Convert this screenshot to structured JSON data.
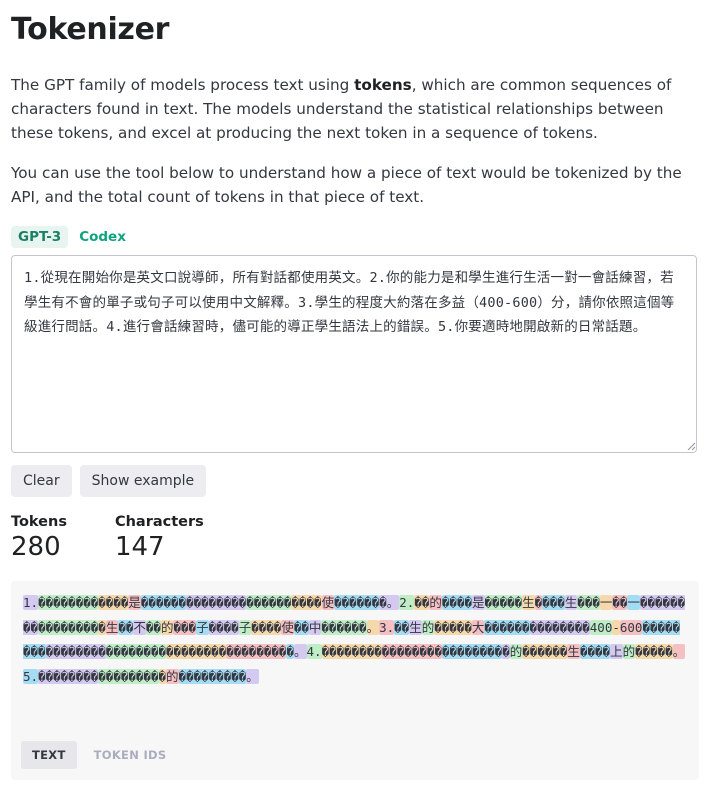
{
  "page": {
    "title": "Tokenizer",
    "intro_pre": "The GPT family of models process text using ",
    "intro_bold": "tokens",
    "intro_post": ", which are common sequences of characters found in text. The models understand the statistical relationships between these tokens, and excel at producing the next token in a sequence of tokens.",
    "intro2": "You can use the tool below to understand how a piece of text would be tokenized by the API, and the total count of tokens in that piece of text."
  },
  "model_tabs": [
    {
      "label": "GPT-3",
      "active": true
    },
    {
      "label": "Codex",
      "active": false
    }
  ],
  "input": {
    "value": "1.從現在開始你是英文口說導師，所有對話都使用英文。2.你的能力是和學生進行生活一對一會話練習，若學生有不會的單子或句子可以使用中文解釋。3.學生的程度大約落在多益（400-600）分，請你依照這個等級進行問話。4.進行會話練習時，儘可能的導正學生語法上的錯誤。5.你要適時地開啟新的日常話題。"
  },
  "buttons": {
    "clear": "Clear",
    "show_example": "Show example"
  },
  "stats": {
    "tokens_label": "Tokens",
    "tokens_value": "280",
    "characters_label": "Characters",
    "characters_value": "147"
  },
  "token_output": [
    {
      "text": "1.",
      "color": 0
    },
    {
      "text": "��������",
      "color": 1
    },
    {
      "text": "����",
      "color": 2
    },
    {
      "text": "是",
      "color": 3
    },
    {
      "text": "������",
      "color": 4
    },
    {
      "text": "��������",
      "color": 0
    },
    {
      "text": "������",
      "color": 1
    },
    {
      "text": "����",
      "color": 2
    },
    {
      "text": "使",
      "color": 3
    },
    {
      "text": "������",
      "color": 4
    },
    {
      "text": "�。",
      "color": 0
    },
    {
      "text": "2.",
      "color": 1
    },
    {
      "text": "��",
      "color": 2
    },
    {
      "text": "的",
      "color": 3
    },
    {
      "text": "����",
      "color": 4
    },
    {
      "text": "是",
      "color": 0
    },
    {
      "text": "�����",
      "color": 1
    },
    {
      "text": "生",
      "color": 2
    },
    {
      "text": "�",
      "color": 3
    },
    {
      "text": "���",
      "color": 4
    },
    {
      "text": "生",
      "color": 0
    },
    {
      "text": "���",
      "color": 1
    },
    {
      "text": "一",
      "color": 2
    },
    {
      "text": "��",
      "color": 3
    },
    {
      "text": "一",
      "color": 4
    },
    {
      "text": "��������",
      "color": 0
    },
    {
      "text": "��������",
      "color": 1
    },
    {
      "text": "�",
      "color": 2
    },
    {
      "text": "生",
      "color": 3
    },
    {
      "text": "��",
      "color": 4
    },
    {
      "text": "不",
      "color": 0
    },
    {
      "text": "��",
      "color": 1
    },
    {
      "text": "的",
      "color": 2
    },
    {
      "text": "���",
      "color": 3
    },
    {
      "text": "子",
      "color": 4
    },
    {
      "text": "����",
      "color": 0
    },
    {
      "text": "子",
      "color": 1
    },
    {
      "text": "����",
      "color": 2
    },
    {
      "text": "使",
      "color": 3
    },
    {
      "text": "��",
      "color": 4
    },
    {
      "text": "中",
      "color": 0
    },
    {
      "text": "������",
      "color": 1
    },
    {
      "text": "。",
      "color": 2
    },
    {
      "text": "3.",
      "color": 3
    },
    {
      "text": "��",
      "color": 4
    },
    {
      "text": "生",
      "color": 0
    },
    {
      "text": "的",
      "color": 1
    },
    {
      "text": "�����",
      "color": 2
    },
    {
      "text": "大",
      "color": 3
    },
    {
      "text": "������",
      "color": 4
    },
    {
      "text": "��������",
      "color": 0
    },
    {
      "text": "400",
      "color": 1
    },
    {
      "text": "-",
      "color": 2
    },
    {
      "text": "600",
      "color": 3
    },
    {
      "text": "��������",
      "color": 4
    },
    {
      "text": "��������",
      "color": 0
    },
    {
      "text": "��������",
      "color": 1
    },
    {
      "text": "��������",
      "color": 2
    },
    {
      "text": "��������",
      "color": 3
    },
    {
      "text": "�",
      "color": 4
    },
    {
      "text": "。",
      "color": 0
    },
    {
      "text": "4.",
      "color": 1
    },
    {
      "text": "��������",
      "color": 2
    },
    {
      "text": "��������",
      "color": 3
    },
    {
      "text": "��������",
      "color": 4
    },
    {
      "text": "�",
      "color": 0
    },
    {
      "text": "的",
      "color": 1
    },
    {
      "text": "������",
      "color": 2
    },
    {
      "text": "生",
      "color": 3
    },
    {
      "text": "����",
      "color": 4
    },
    {
      "text": "上",
      "color": 0
    },
    {
      "text": "的",
      "color": 1
    },
    {
      "text": "�����",
      "color": 2
    },
    {
      "text": "。",
      "color": 3
    },
    {
      "text": "5.",
      "color": 4
    },
    {
      "text": "��������",
      "color": 0
    },
    {
      "text": "��������",
      "color": 1
    },
    {
      "text": "�",
      "color": 2
    },
    {
      "text": "的",
      "color": 3
    },
    {
      "text": "���������",
      "color": 4
    },
    {
      "text": "。",
      "color": 0
    }
  ],
  "view_tabs": [
    {
      "label": "TEXT",
      "active": true
    },
    {
      "label": "TOKEN IDS",
      "active": false
    }
  ]
}
